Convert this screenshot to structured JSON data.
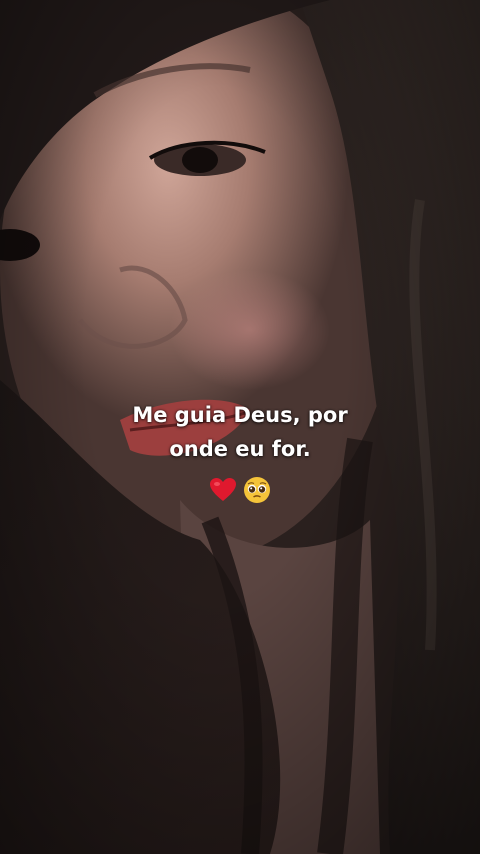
{
  "story": {
    "caption_line1": "Me guia Deus, por",
    "caption_line2": "onde eu for.",
    "emojis": [
      "red-heart-icon",
      "pleading-face-icon"
    ]
  },
  "colors": {
    "background": "#1a1514",
    "caption_text": "#ffffff",
    "heart": "#e0192e",
    "pleading_face": "#f5c43a"
  }
}
